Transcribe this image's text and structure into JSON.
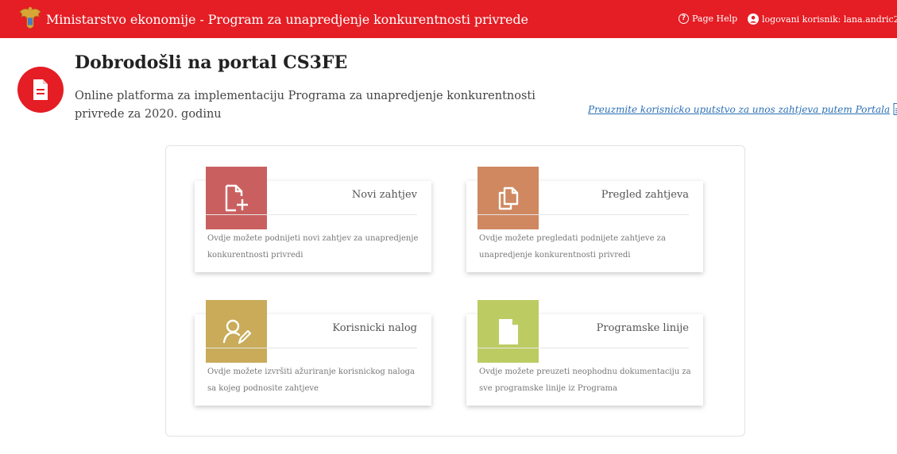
{
  "header": {
    "app_title": "Ministarstvo ekonomije - Program za unapredjenje konkurentnosti privrede",
    "help_label": "Page Help",
    "user_label": "logovani korisnik: lana.andric2",
    "background": "#e51d24",
    "logo_icon": "coat-of-arms-icon"
  },
  "hero": {
    "icon": "document-icon",
    "title": "Dobrodošli na portal CS3FE",
    "subtitle": "Online platforma za implementaciju Programa za unapredjenje konkurentnosti privrede za 2020. godinu",
    "download_link": "Preuzmite korisnicko uputstvo za unos zahtjeva putem Portala"
  },
  "cards": [
    {
      "title": "Novi zahtjev",
      "description": "Ovdje možete podnijeti novi zahtjev za unapredjenje konkurentnosti privredi",
      "color": "#c9605f",
      "icon": "new-document-icon"
    },
    {
      "title": "Pregled zahtjeva",
      "description": "Ovdje možete pregledati podnijete zahtjeve za unapredjenje konkurentnosti privredi",
      "color": "#cf8860",
      "icon": "documents-icon"
    },
    {
      "title": "Korisnicki nalog",
      "description": "Ovdje možete izvršiti ažuriranje korisnickog naloga sa kojeg podnosite zahtjeve",
      "color": "#c9ab5a",
      "icon": "user-edit-icon"
    },
    {
      "title": "Programske linije",
      "description": "Ovdje možete preuzeti neophodnu dokumentaciju za sve programske linije iz Programa",
      "color": "#bccc62",
      "icon": "file-icon"
    }
  ]
}
